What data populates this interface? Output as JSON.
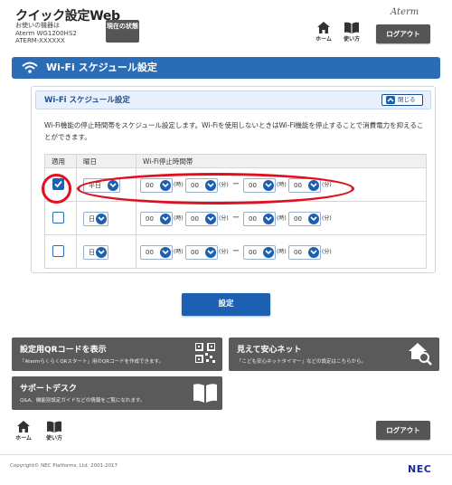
{
  "header": {
    "site_title": "クイック設定Web",
    "device_caption": "お使いの機器は",
    "device_model": "Aterm WG1200HS2",
    "device_serial": "ATERM-XXXXXX",
    "status_button": "現在の状態",
    "brand": "Aterm",
    "home_label": "ホーム",
    "help_label": "使い方",
    "logout_label": "ログアウト"
  },
  "page": {
    "title": "Wi-Fi スケジュール設定",
    "panel_title": "Wi-Fi スケジュール設定",
    "close_label": "閉じる",
    "description": "Wi-Fi機能の停止時間帯をスケジュール設定します。Wi-Fiを使用しないときはWi-Fi機能を停止することで消費電力を抑えることができます。"
  },
  "table": {
    "headers": [
      "適用",
      "曜日",
      "Wi-Fi停止時間帯"
    ],
    "unit_hour": "(時)",
    "unit_min": "(分)",
    "dash": "ー",
    "rows": [
      {
        "checked": true,
        "day": "平日",
        "start_h": "00",
        "start_m": "00",
        "end_h": "00",
        "end_m": "00"
      },
      {
        "checked": false,
        "day": "日",
        "start_h": "00",
        "start_m": "00",
        "end_h": "00",
        "end_m": "00"
      },
      {
        "checked": false,
        "day": "日",
        "start_h": "00",
        "start_m": "00",
        "end_h": "00",
        "end_m": "00"
      }
    ]
  },
  "submit_label": "設定",
  "tiles": {
    "qr_title": "設定用QRコードを表示",
    "qr_sub": "「AtermらくらくQRスタート」用のQRコードを作成できます。",
    "safety_title": "見えて安心ネット",
    "safety_sub": "「こども安心ネットタイマー」などの設定はこちらから。",
    "support_title": "サポートデスク",
    "support_sub": "Q&A、機能別設定ガイドなどの情報をご覧になれます。"
  },
  "footer": {
    "home_label": "ホーム",
    "help_label": "使い方",
    "logout_label": "ログアウト",
    "copyright": "Copyright© NEC Platforms, Ltd. 2001-2017",
    "brand": "NEC"
  },
  "colors": {
    "accent": "#1d5fb0",
    "title_bar": "#2a6db6",
    "tile": "#5a5a5a",
    "highlight": "#e01020"
  }
}
